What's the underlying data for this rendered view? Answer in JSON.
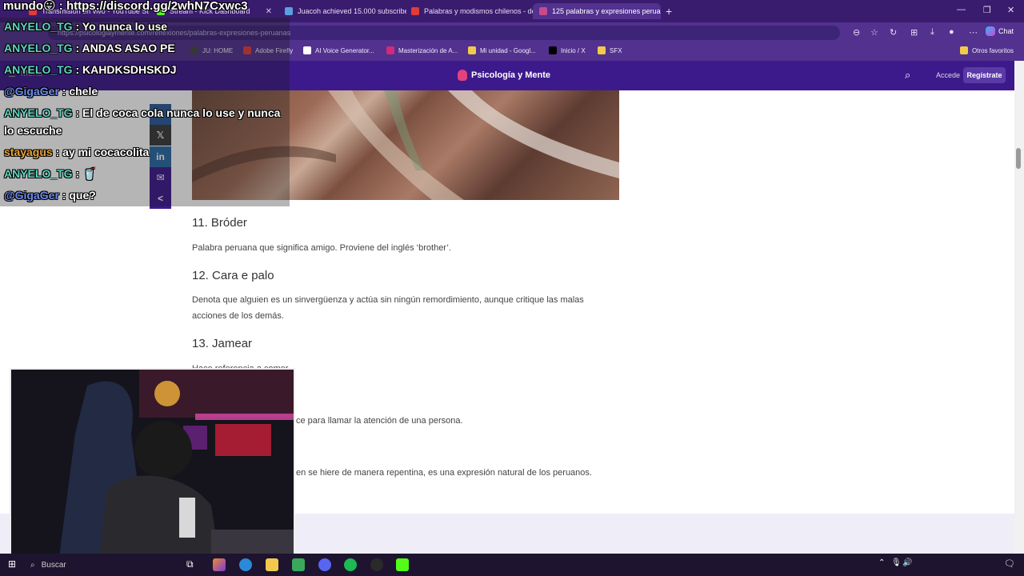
{
  "browser": {
    "tabs": [
      {
        "title": "Transmisión en vivo - YouTube St",
        "fav": "#e23b3b"
      },
      {
        "title": "Stream - Kick Dashboard",
        "fav": "#53fc18"
      },
      {
        "title": "Juacoh achieved 15.000 subscribe",
        "fav": "#5aa0e0"
      },
      {
        "title": "Palabras y modismos chilenos - de",
        "fav": "#e23b3b"
      },
      {
        "title": "125 palabras y expresiones perua",
        "fav": "#c84a8a"
      }
    ],
    "url": "https://psicologiaymente.com/reflexiones/palabras-expresiones-peruanas",
    "chat_label": "Chat",
    "bookmarks": [
      {
        "label": "JU: HOME",
        "fav": "#444"
      },
      {
        "label": "Adobe Firefly",
        "fav": "#e23b3b"
      },
      {
        "label": "AI Voice Generator...",
        "fav": "#fff"
      },
      {
        "label": "Masterización de A...",
        "fav": "#d02a7a"
      },
      {
        "label": "Mi unidad - Googl...",
        "fav": "#f2c94c"
      },
      {
        "label": "Inicio / X",
        "fav": "#000"
      },
      {
        "label": "SFX",
        "fav": "#f2c94c"
      }
    ],
    "other_bookmarks": "Otros favoritos"
  },
  "site": {
    "brand": "Psicología y Mente",
    "menu": "Menu",
    "login": "Accede",
    "register": "Regístrate"
  },
  "article": {
    "items": [
      {
        "heading": "11. Bróder",
        "text": "Palabra peruana que significa amigo. Proviene del inglés ‘brother’."
      },
      {
        "heading": "12. Cara e palo",
        "text": "Denota que alguien es un sinvergüenza y actúa sin ningún remordimiento, aunque critique las malas acciones de los demás."
      },
      {
        "heading": "13. Jamear",
        "text": "Hace referencia a comer."
      }
    ],
    "partial1": "ce para llamar la atención de una persona.",
    "partial2": "en se hiere de manera repentina, es una expresión natural de los peruanos."
  },
  "share": [
    {
      "label": "f",
      "icon": "facebook-icon",
      "color": "#2c5a9a"
    },
    {
      "label": "𝕏",
      "icon": "x-icon",
      "color": "#3a3a3a"
    },
    {
      "label": "in",
      "icon": "linkedin-icon",
      "color": "#2a6aa5"
    },
    {
      "label": "✉",
      "icon": "email-icon",
      "color": "#3d1a8c"
    },
    {
      "label": "<",
      "icon": "share-icon",
      "color": "#3d1a8c"
    }
  ],
  "overlay": {
    "discord": "mundo😛 : https://discord.gg/2whN7Cxwc3",
    "chat": [
      {
        "user": "ANYELO_TG",
        "msg": " : Yo nunca lo use",
        "type": "teal"
      },
      {
        "user": "ANYELO_TG",
        "msg": " : ANDAS ASAO PE",
        "type": "teal"
      },
      {
        "user": "ANYELO_TG",
        "msg": " : KAHDKSDHSKDJ",
        "type": "teal"
      },
      {
        "user": "@GigaGer",
        "msg": " : chele",
        "type": "mention"
      },
      {
        "user": "ANYELO_TG",
        "msg": " : El de coca cola nunca lo use y nunca",
        "type": "teal"
      },
      {
        "user": "",
        "msg": "lo escuche",
        "type": "cont"
      },
      {
        "user": "stayagus",
        "msg": " : ay mi cocacolita",
        "type": "orange"
      },
      {
        "user": "ANYELO_TG",
        "msg": " : 🥤",
        "type": "teal"
      },
      {
        "user": "@GigaGer",
        "msg": " : que?",
        "type": "mention"
      }
    ]
  },
  "taskbar": {
    "search": "Buscar"
  }
}
